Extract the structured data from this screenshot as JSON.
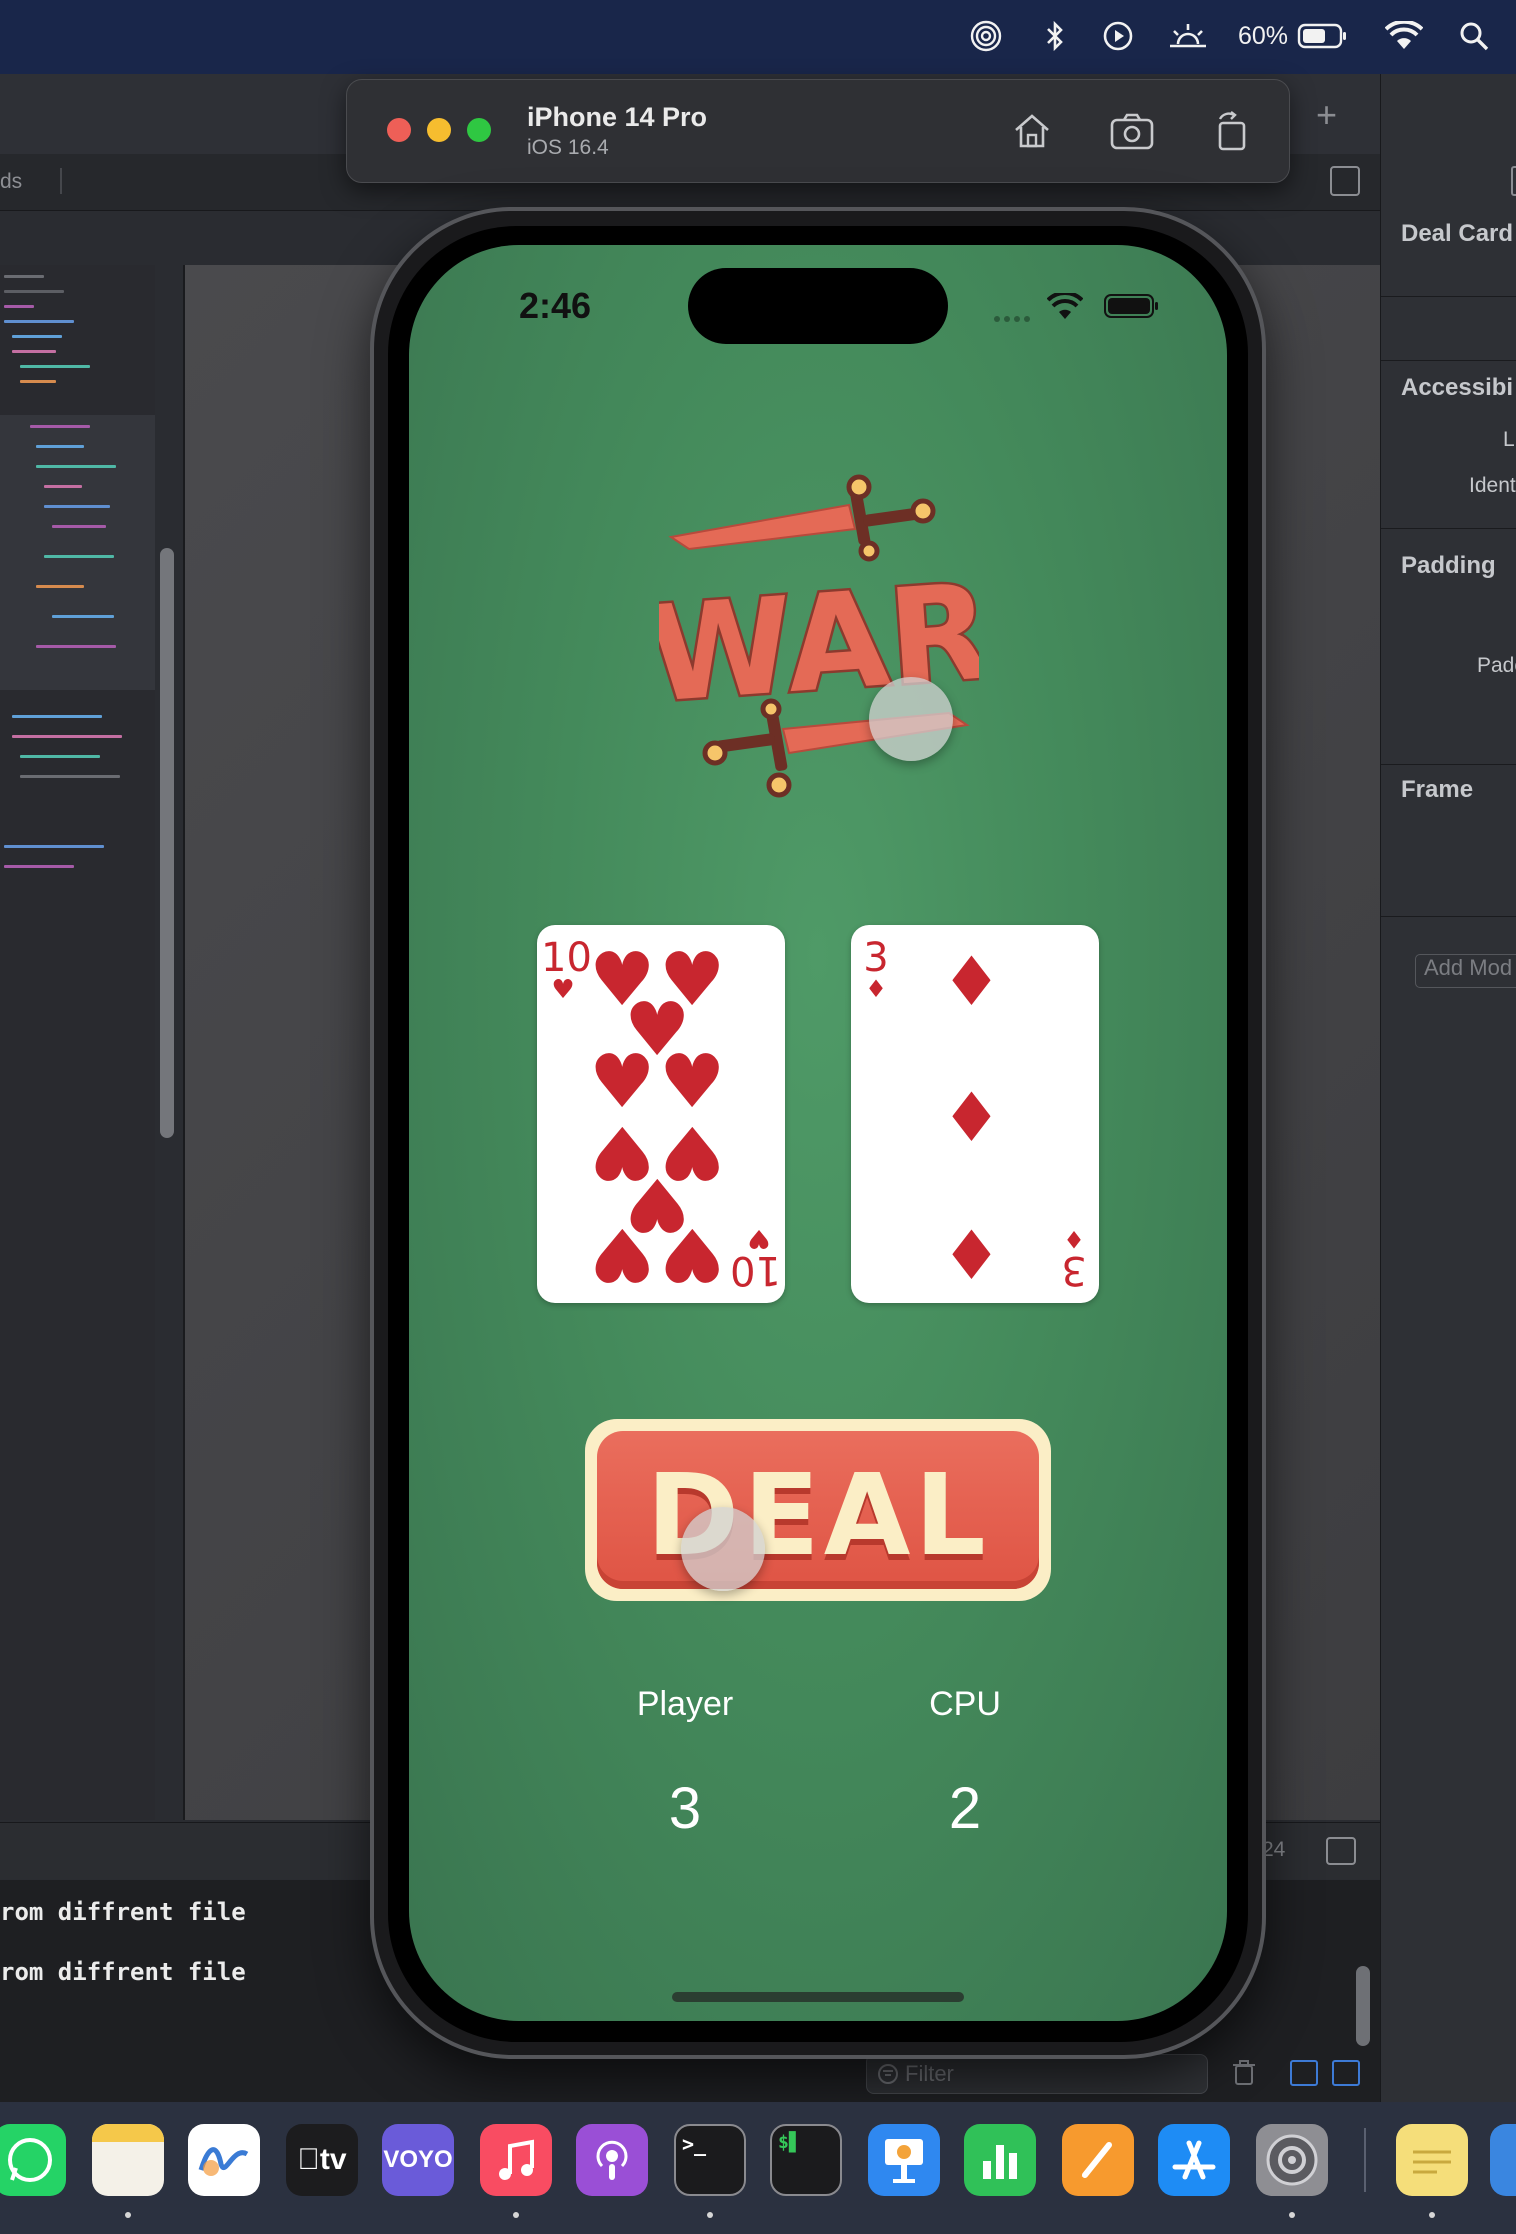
{
  "menubar": {
    "battery_percent": "60%",
    "icons": [
      "airdrop-icon",
      "bluetooth-icon",
      "play-circle-icon",
      "brightness-icon",
      "battery-icon",
      "wifi-icon",
      "search-icon"
    ]
  },
  "xcode": {
    "tab_fragment": "ds",
    "line_number": "24",
    "console_lines": [
      "rom diffrent file",
      "rom diffrent file"
    ],
    "filter_placeholder": "Filter"
  },
  "inspector": {
    "sections": [
      "Deal Card",
      "Accessibi",
      "Padding",
      "Frame"
    ],
    "labels": [
      "L",
      "Ident",
      "Padc"
    ],
    "add_modifier": "Add Mod"
  },
  "simulator": {
    "device": "iPhone 14 Pro",
    "os": "iOS 16.4",
    "tools": [
      "home-icon",
      "screenshot-icon",
      "rotate-icon"
    ]
  },
  "phone": {
    "time": "2:46",
    "logo_text": "WAR",
    "cards": [
      {
        "rank": "10",
        "suit": "♥",
        "suit_name": "hearts"
      },
      {
        "rank": "3",
        "suit": "♦",
        "suit_name": "diamonds"
      }
    ],
    "deal_label": "DEAL",
    "player_label": "Player",
    "cpu_label": "CPU",
    "player_score": "3",
    "cpu_score": "2"
  },
  "colors": {
    "felt": "#4a8f5e",
    "card_red": "#c8262f",
    "deal_red": "#e25e4c",
    "deal_cream": "#fbeec6"
  },
  "dock": {
    "apps": [
      "WhatsApp",
      "Notes",
      "Freeform",
      "Apple TV",
      "VOYO",
      "Music",
      "Podcasts",
      "Terminal",
      "Terminal 2",
      "Keynote",
      "Numbers",
      "Pages",
      "App Store",
      "System Settings",
      "Stickies"
    ],
    "voyo_label": "VOYO",
    "tv_label": "tv"
  }
}
